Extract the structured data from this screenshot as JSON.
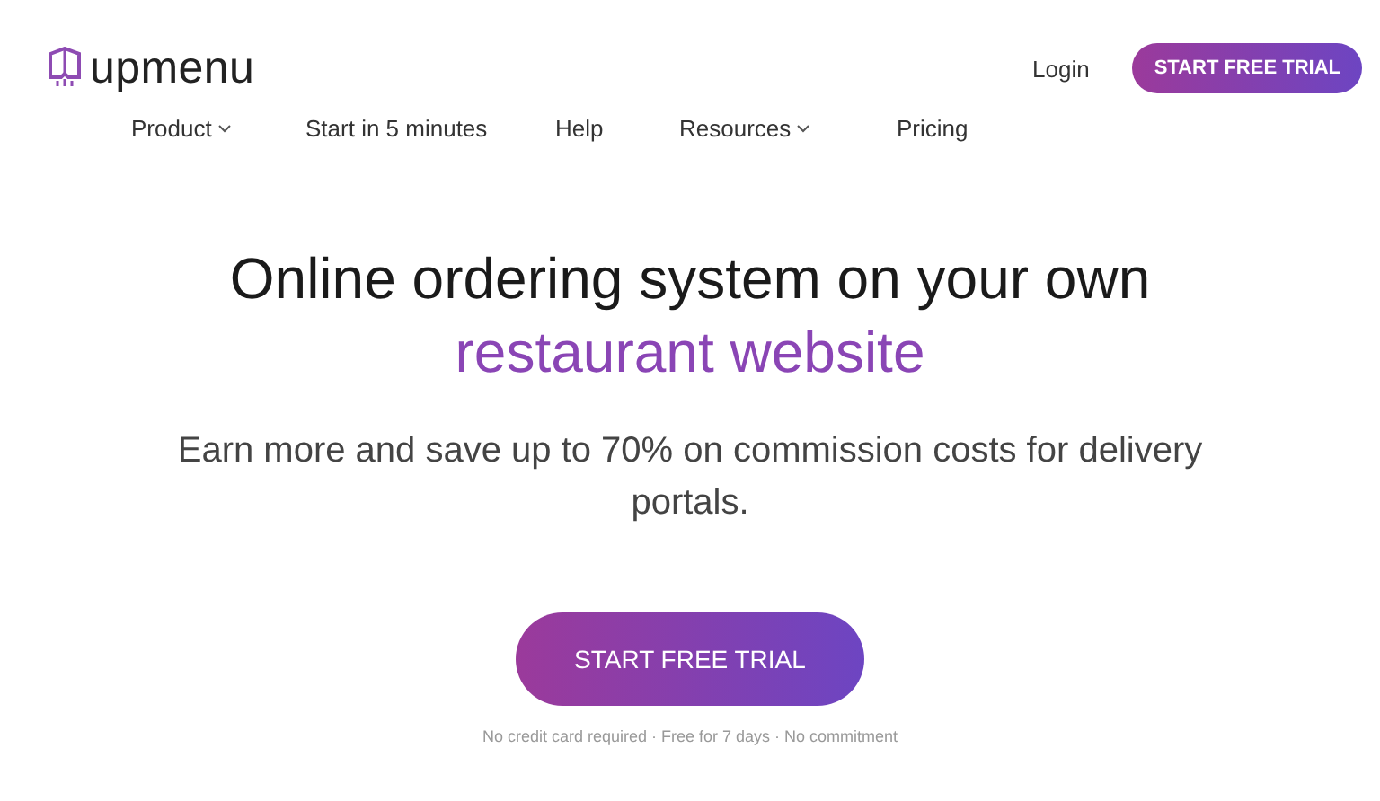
{
  "header": {
    "logo": "upmenu",
    "login": "Login",
    "cta": "START FREE TRIAL"
  },
  "nav": [
    {
      "label": "Product",
      "dropdown": true
    },
    {
      "label": "Start in 5 minutes",
      "dropdown": false
    },
    {
      "label": "Help",
      "dropdown": false
    },
    {
      "label": "Resources",
      "dropdown": true
    },
    {
      "label": "Pricing",
      "dropdown": false
    }
  ],
  "hero": {
    "title": "Online ordering system on your own",
    "title_accent": "restaurant website",
    "subtitle": "Earn more and save up to 70% on commission costs for delivery portals.",
    "cta": "START FREE TRIAL",
    "note": "No credit card required · Free for 7 days · No commitment"
  }
}
